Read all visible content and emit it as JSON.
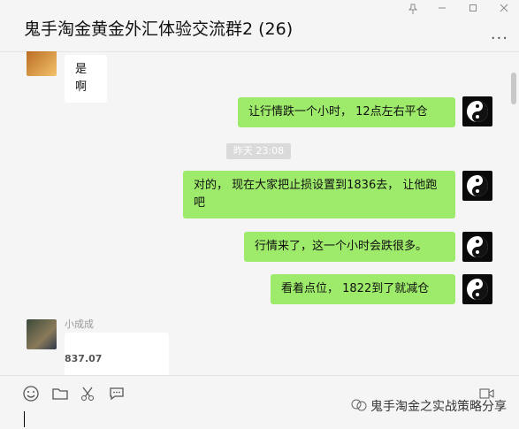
{
  "window": {
    "title": "鬼手淘金黄金外汇体验交流群2 (26)",
    "controls": [
      "pin-icon",
      "minimize-icon",
      "maximize-icon",
      "close-icon"
    ],
    "more_label": "..."
  },
  "messages": [
    {
      "side": "left",
      "text": "是啊"
    },
    {
      "side": "right",
      "text": "让行情跌一个小时， 12点左右平仓"
    },
    {
      "type": "time",
      "text": "昨天 23:08"
    },
    {
      "side": "right",
      "text": "对的， 现在大家把止损设置到1836去， 让他跑吧"
    },
    {
      "side": "right",
      "text": "行情来了，这一个小时会跌很多。"
    },
    {
      "side": "right",
      "text": "看着点位， 1822到了就减仓"
    },
    {
      "side": "left",
      "sender": "小成成",
      "partial_text": "837.07"
    }
  ],
  "toolbar": {
    "icons": [
      "emoji-icon",
      "folder-icon",
      "scissors-icon",
      "chat-bubble-icon"
    ],
    "video_call_icon": "video-call-icon"
  },
  "watermark": {
    "text": "鬼手淘金之实战策略分享"
  },
  "colors": {
    "bubble_right": "#9eea6a",
    "bubble_left": "#ffffff",
    "bg": "#f5f5f5"
  }
}
